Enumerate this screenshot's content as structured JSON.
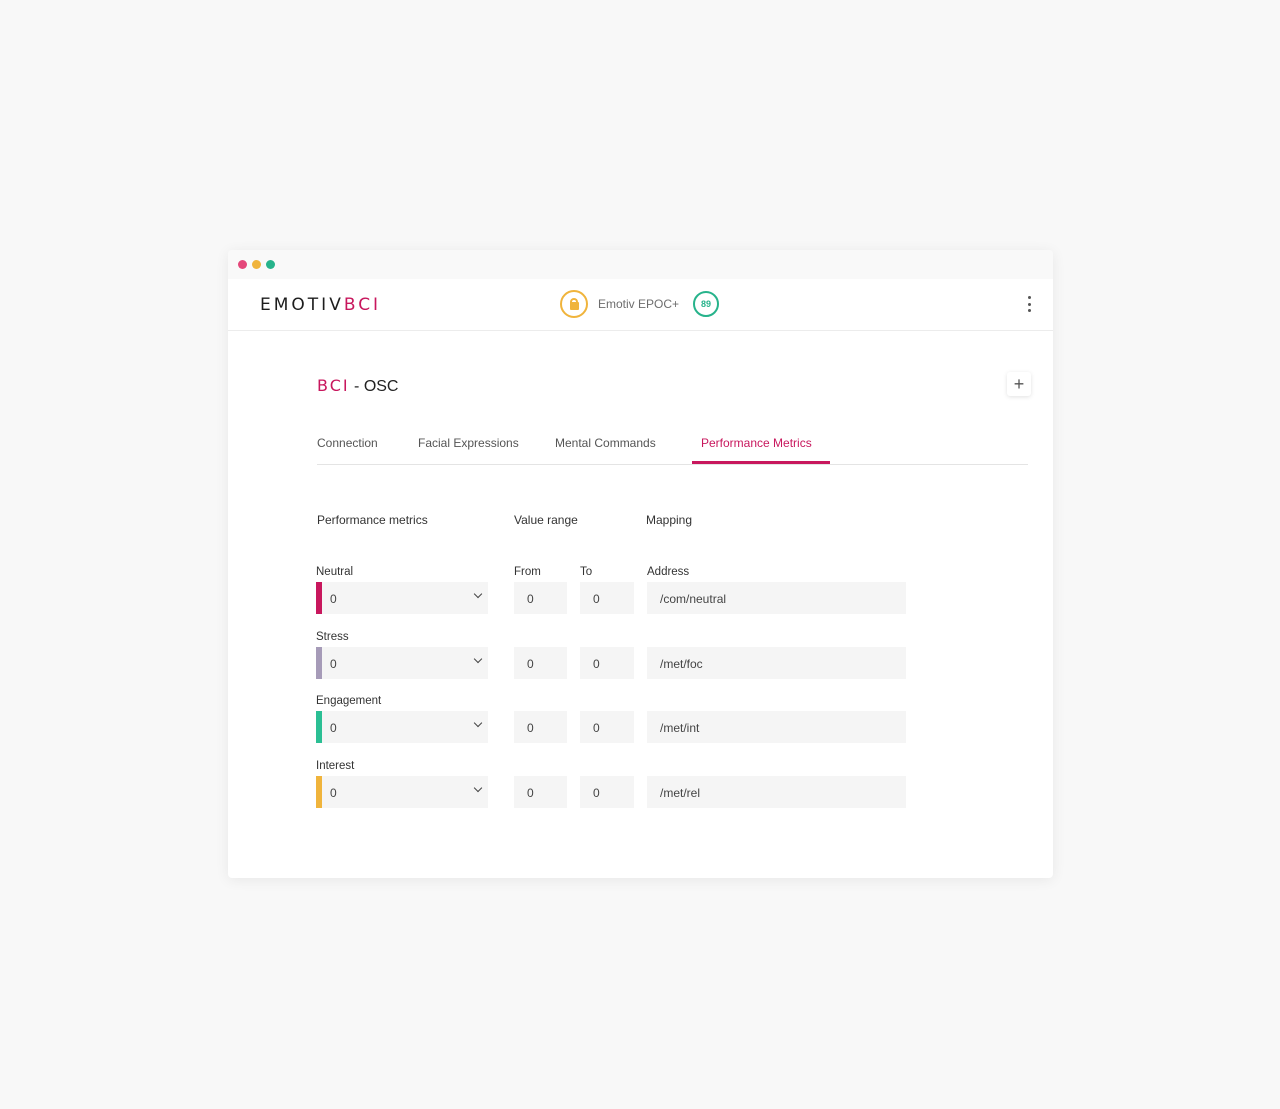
{
  "window": {
    "traffic_lights": [
      {
        "name": "close",
        "color": "#e4477a"
      },
      {
        "name": "minimize",
        "color": "#f0b43c"
      },
      {
        "name": "maximize",
        "color": "#27b38b"
      }
    ]
  },
  "header": {
    "logo_main": "EMOTIV",
    "logo_accent": "BCI",
    "device_name": "Emotiv EPOC+",
    "battery": "89"
  },
  "page": {
    "title_accent": "BCI",
    "title_rest": " - OSC"
  },
  "tabs": [
    {
      "label": "Connection",
      "active": false
    },
    {
      "label": "Facial Expressions",
      "active": false
    },
    {
      "label": "Mental Commands",
      "active": false
    },
    {
      "label": "Performance Metrics",
      "active": true
    }
  ],
  "columns": {
    "metrics": "Performance metrics",
    "range": "Value range",
    "mapping": "Mapping"
  },
  "field_labels": {
    "from": "From",
    "to": "To",
    "address": "Address"
  },
  "rows": [
    {
      "label": "Neutral",
      "value": "0",
      "from": "0",
      "to": "0",
      "address": "/com/neutral",
      "color": "#c8175d"
    },
    {
      "label": "Stress",
      "value": "0",
      "from": "0",
      "to": "0",
      "address": "/met/foc",
      "color": "#a69bb8"
    },
    {
      "label": "Engagement",
      "value": "0",
      "from": "0",
      "to": "0",
      "address": "/met/int",
      "color": "#2bbf94"
    },
    {
      "label": "Interest",
      "value": "0",
      "from": "0",
      "to": "0",
      "address": "/met/rel",
      "color": "#f0b43c"
    }
  ],
  "colors": {
    "accent": "#c8175d",
    "battery": "#27b38b",
    "lock": "#f0b43c"
  }
}
